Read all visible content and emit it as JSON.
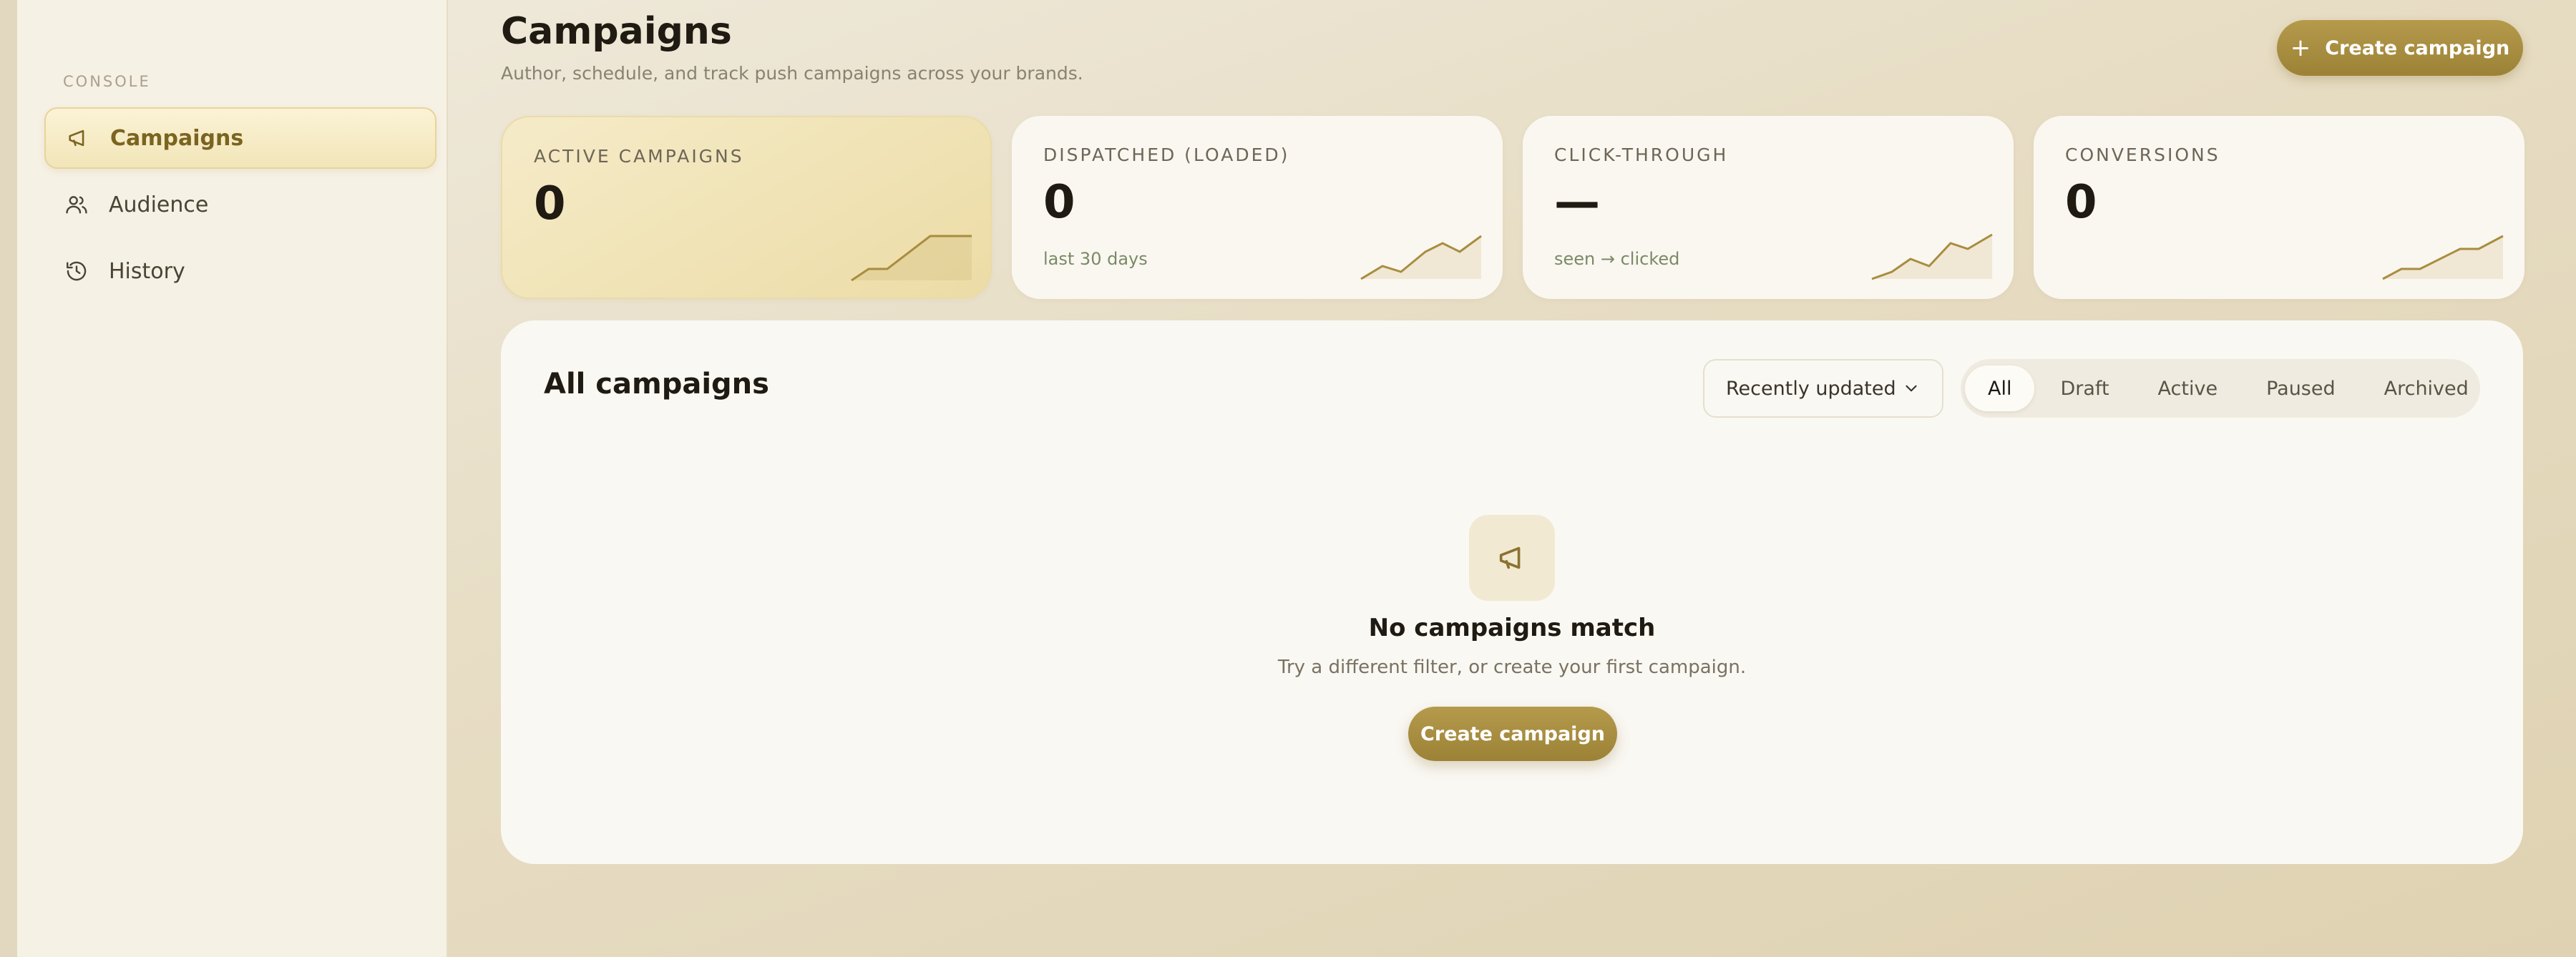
{
  "sidebar": {
    "section_label": "CONSOLE",
    "items": [
      {
        "label": "Campaigns",
        "icon": "megaphone-icon",
        "active": true
      },
      {
        "label": "Audience",
        "icon": "users-icon",
        "active": false
      },
      {
        "label": "History",
        "icon": "history-icon",
        "active": false
      }
    ]
  },
  "header": {
    "title": "Campaigns",
    "subtitle": "Author, schedule, and track push campaigns across your brands.",
    "create_button": "Create campaign",
    "create_icon": "plus-icon"
  },
  "stats": [
    {
      "label": "ACTIVE CAMPAIGNS",
      "value": "0",
      "sub": ""
    },
    {
      "label": "DISPATCHED (LOADED)",
      "value": "0",
      "sub": "last 30 days"
    },
    {
      "label": "CLICK-THROUGH",
      "value": "—",
      "sub": "seen → clicked"
    },
    {
      "label": "CONVERSIONS",
      "value": "0",
      "sub": ""
    }
  ],
  "panel": {
    "title": "All campaigns",
    "sort": {
      "selected": "Recently updated",
      "icon": "chevron-down-icon"
    },
    "filters": [
      "All",
      "Draft",
      "Active",
      "Paused",
      "Archived"
    ],
    "active_filter": "All",
    "empty": {
      "icon": "megaphone-icon",
      "title": "No campaigns match",
      "subtitle": "Try a different filter, or create your first campaign.",
      "button": "Create campaign"
    }
  },
  "colors": {
    "accent": "#a88d3f",
    "sidebar_bg": "#f6f1e5",
    "card_bg": "#faf7f1",
    "text_dark": "#1f1a12",
    "sub_green": "#7a8a66"
  }
}
